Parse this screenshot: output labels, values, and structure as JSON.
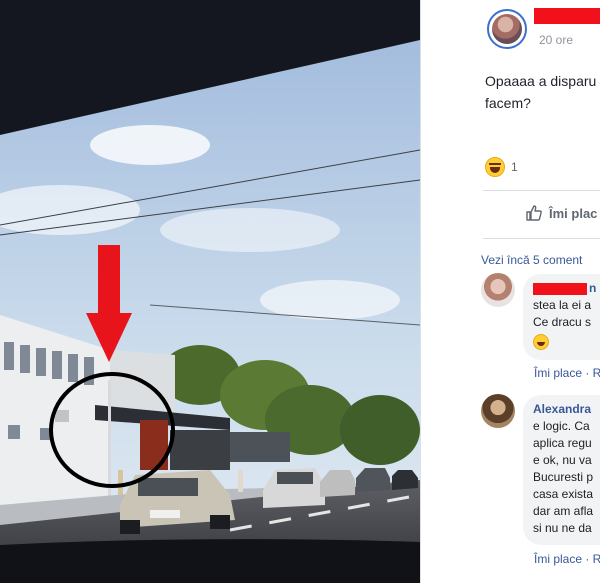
{
  "post": {
    "time": "20 ore",
    "text_line1": "Opaaaa a disparu",
    "text_line2": "facem?",
    "reaction_count": "1",
    "like_label": "Îmi plac"
  },
  "comments": {
    "more_label": "Vezi încă 5 coment",
    "items": [
      {
        "name": "n G",
        "line1": "stea la ei a",
        "line2": "Ce dracu s",
        "action": "Îmi place · R"
      },
      {
        "name": "Alexandra",
        "lines": [
          "e logic. Ca",
          "aplica regu",
          "e ok, nu va",
          "Bucuresti p",
          "casa exista",
          "dar am afla",
          "si nu ne da"
        ],
        "action": "Îmi place · R"
      }
    ]
  },
  "colors": {
    "redaction": "#f2101a",
    "link": "#385898",
    "annotation": "#e8141c"
  }
}
